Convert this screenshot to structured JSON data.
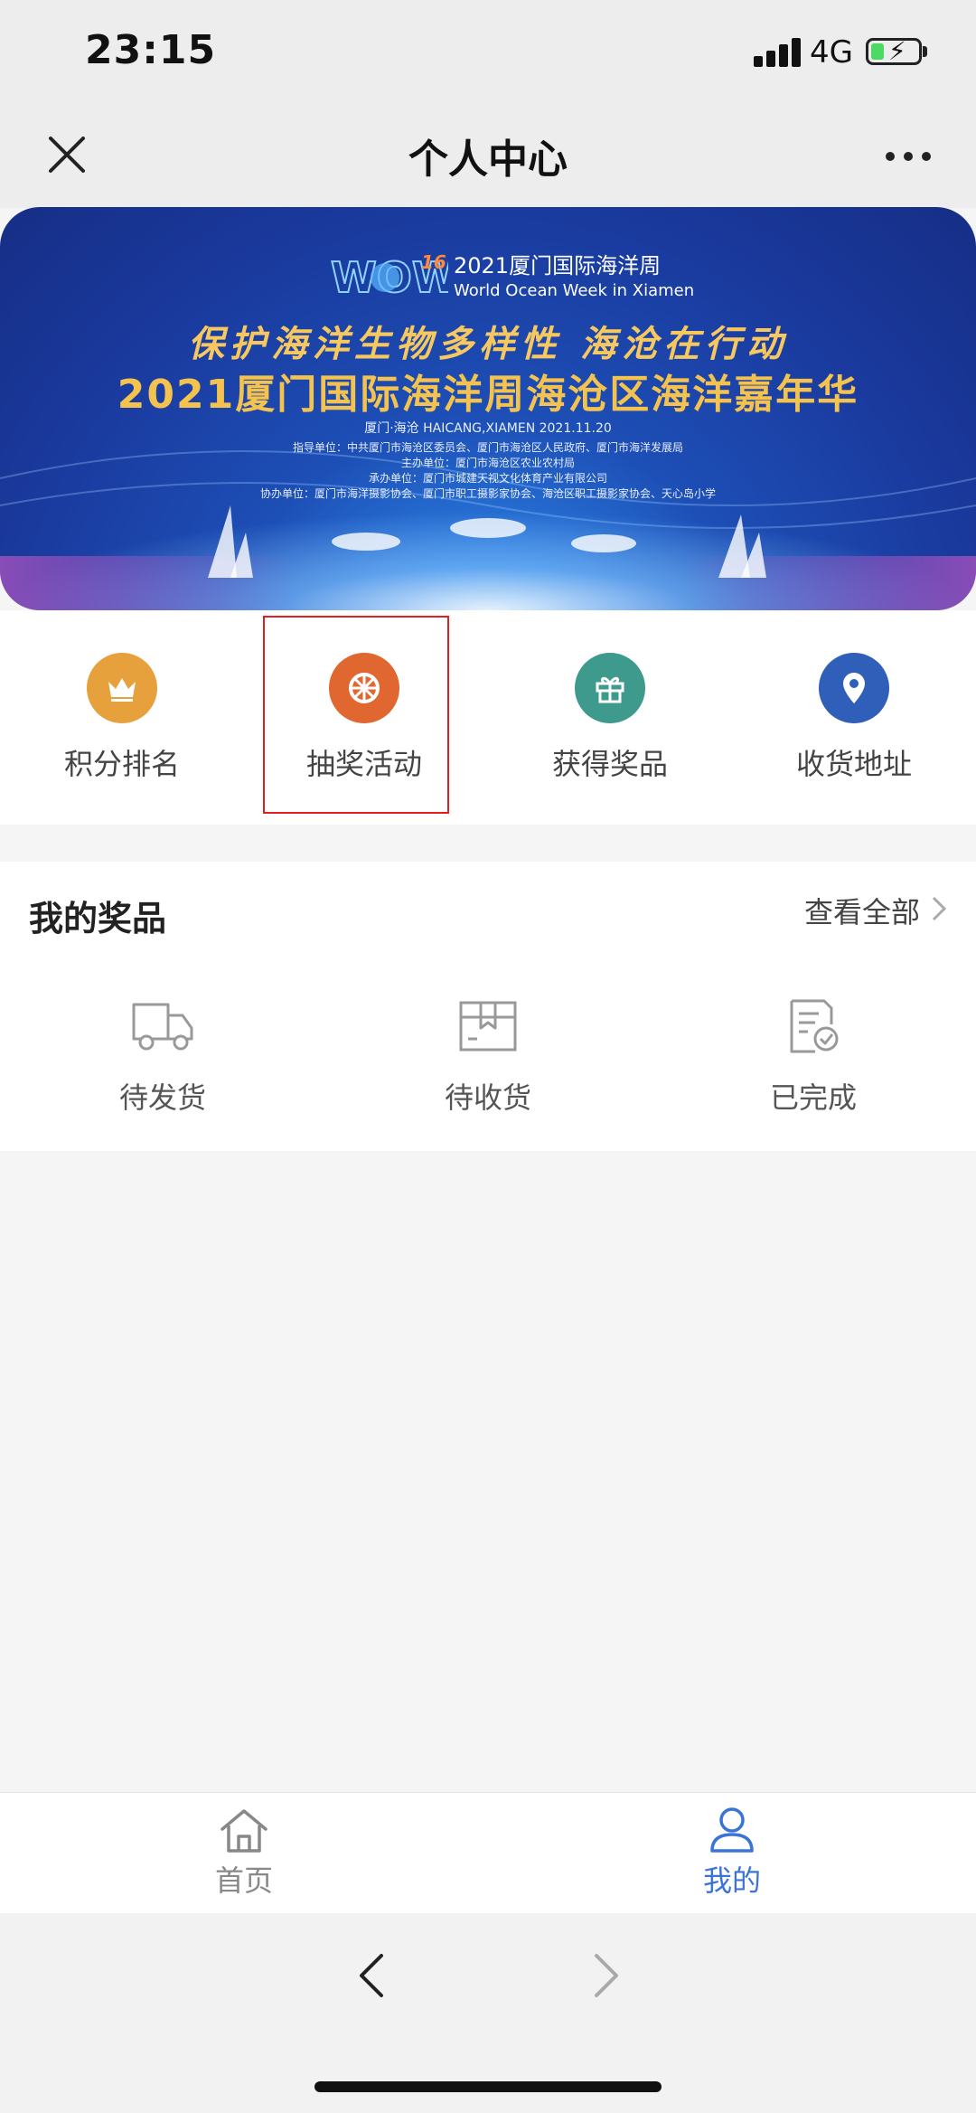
{
  "status_bar": {
    "time": "23:15",
    "network": "4G"
  },
  "nav": {
    "title": "个人中心"
  },
  "banner": {
    "logo_text": "WOW",
    "logo_number": "16",
    "event_title_cn": "2021厦门国际海洋周",
    "event_title_en": "World Ocean Week in Xiamen",
    "slogan": "保护海洋生物多样性 海沧在行动",
    "headline": "2021厦门国际海洋周海沧区海洋嘉年华",
    "place_date": "厦门·海沧 HAICANG,XIAMEN  2021.11.20",
    "guide_unit": "指导单位：中共厦门市海沧区委员会、厦门市海沧区人民政府、厦门市海洋发展局",
    "host_unit": "主办单位：厦门市海沧区农业农村局",
    "organizer_unit": "承办单位：厦门市城建天视文化体育产业有限公司",
    "co_unit": "协办单位：厦门市海洋摄影协会、厦门市职工摄影家协会、海沧区职工摄影家协会、天心岛小学"
  },
  "grid": [
    {
      "label": "积分排名",
      "icon": "crown-icon",
      "color": "#e6a13d"
    },
    {
      "label": "抽奖活动",
      "icon": "lottery-wheel-icon",
      "color": "#e0672f"
    },
    {
      "label": "获得奖品",
      "icon": "gift-icon",
      "color": "#3f9a8e"
    },
    {
      "label": "收货地址",
      "icon": "location-pin-icon",
      "color": "#2f5fb8"
    }
  ],
  "prizes": {
    "title": "我的奖品",
    "view_all": "查看全部",
    "items": [
      {
        "label": "待发货",
        "icon": "truck-icon"
      },
      {
        "label": "待收货",
        "icon": "package-icon"
      },
      {
        "label": "已完成",
        "icon": "document-check-icon"
      }
    ]
  },
  "tabbar": {
    "items": [
      {
        "label": "首页",
        "icon": "home-icon",
        "active": false
      },
      {
        "label": "我的",
        "icon": "user-icon",
        "active": true
      }
    ],
    "active_color": "#3a74d8",
    "inactive_color": "#888888"
  }
}
